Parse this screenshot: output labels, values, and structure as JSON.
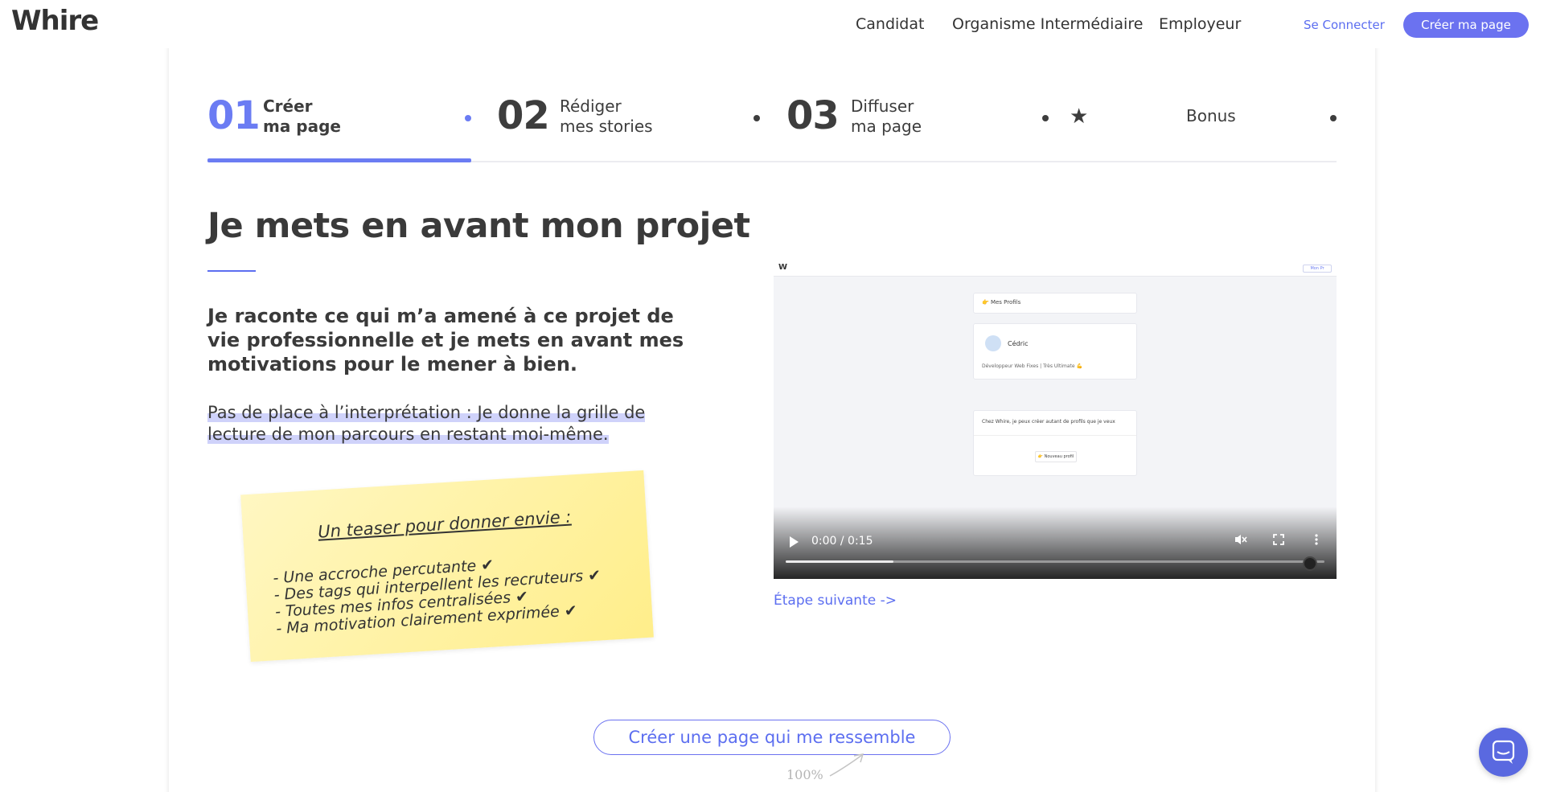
{
  "header": {
    "logo": "Whire",
    "nav": [
      "Candidat",
      "Organisme Intermédiaire",
      "Employeur"
    ],
    "login": "Se Connecter",
    "cta": "Créer ma page"
  },
  "steps": [
    {
      "num": "01",
      "line1": "Créer",
      "line2": "ma page",
      "active": true
    },
    {
      "num": "02",
      "line1": "Rédiger",
      "line2": "mes stories",
      "active": false
    },
    {
      "num": "03",
      "line1": "Diffuser",
      "line2": "ma page",
      "active": false
    },
    {
      "num": "",
      "line1": "Bonus",
      "line2": "",
      "active": false
    }
  ],
  "main": {
    "title": "Je mets en avant mon projet",
    "lead": "Je raconte ce qui m’a amené à ce projet de vie professionnelle et je mets en avant mes motivations pour le mener à bien.",
    "highlight": "Pas de place à l’interprétation : Je donne la grille de lecture de mon parcours en restant moi-même."
  },
  "note": {
    "title": "Un teaser pour donner envie :",
    "items": [
      "- Une accroche percutante ✔",
      "- Des tags qui interpellent les recruteurs ✔",
      "- Toutes mes infos centralisées ✔",
      "- Ma motivation clairement exprimée ✔"
    ]
  },
  "video": {
    "logo": "W",
    "top_button": "Mon Pr",
    "card1": "👉 Mes Profils",
    "card2_name": "Cédric",
    "card2_tags": "Développeur  Web Fixes | Très Ultimate 💪",
    "card3_text": "Chez Whire, je peux créer autant de profils que je veux",
    "card3_button": "👉 Nouveau profil",
    "time": "0:00 / 0:15",
    "progress": 0.0,
    "buffered": 0.2
  },
  "next_step": "Étape suivante  ->",
  "cta_main": "Créer une page qui me ressemble",
  "hand_note": "100%",
  "colors": {
    "accent": "#6b72f0",
    "text": "#3a3a3a",
    "note": "#fff3a8"
  }
}
